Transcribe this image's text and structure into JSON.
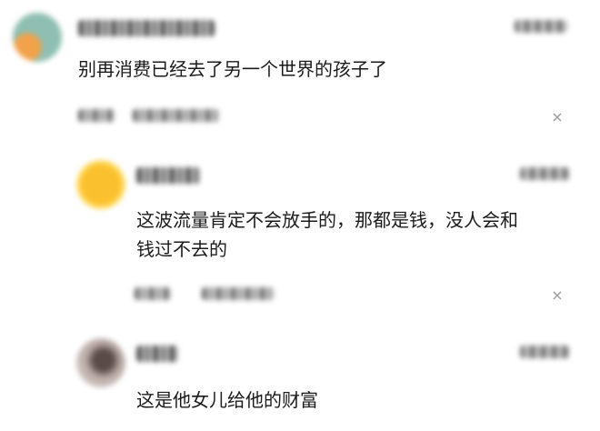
{
  "comments": [
    {
      "text": "别再消费已经去了另一个世界的孩子了",
      "text_lines": [
        "别再消费已经去了另一个世界的孩子了"
      ]
    },
    {
      "text": "这波流量肯定不会放手的，那都是钱，没人会和钱过不去的",
      "text_lines": [
        "这波流量肯定不会放手的，那都是钱，没人会和",
        "钱过不去的"
      ]
    },
    {
      "text": "这是他女儿给他的财富",
      "text_lines": [
        "这是他女儿给他的财富"
      ]
    }
  ],
  "icons": {
    "avatar": "avatar-image",
    "dismiss": "close-icon",
    "dismiss_glyph": "×"
  }
}
